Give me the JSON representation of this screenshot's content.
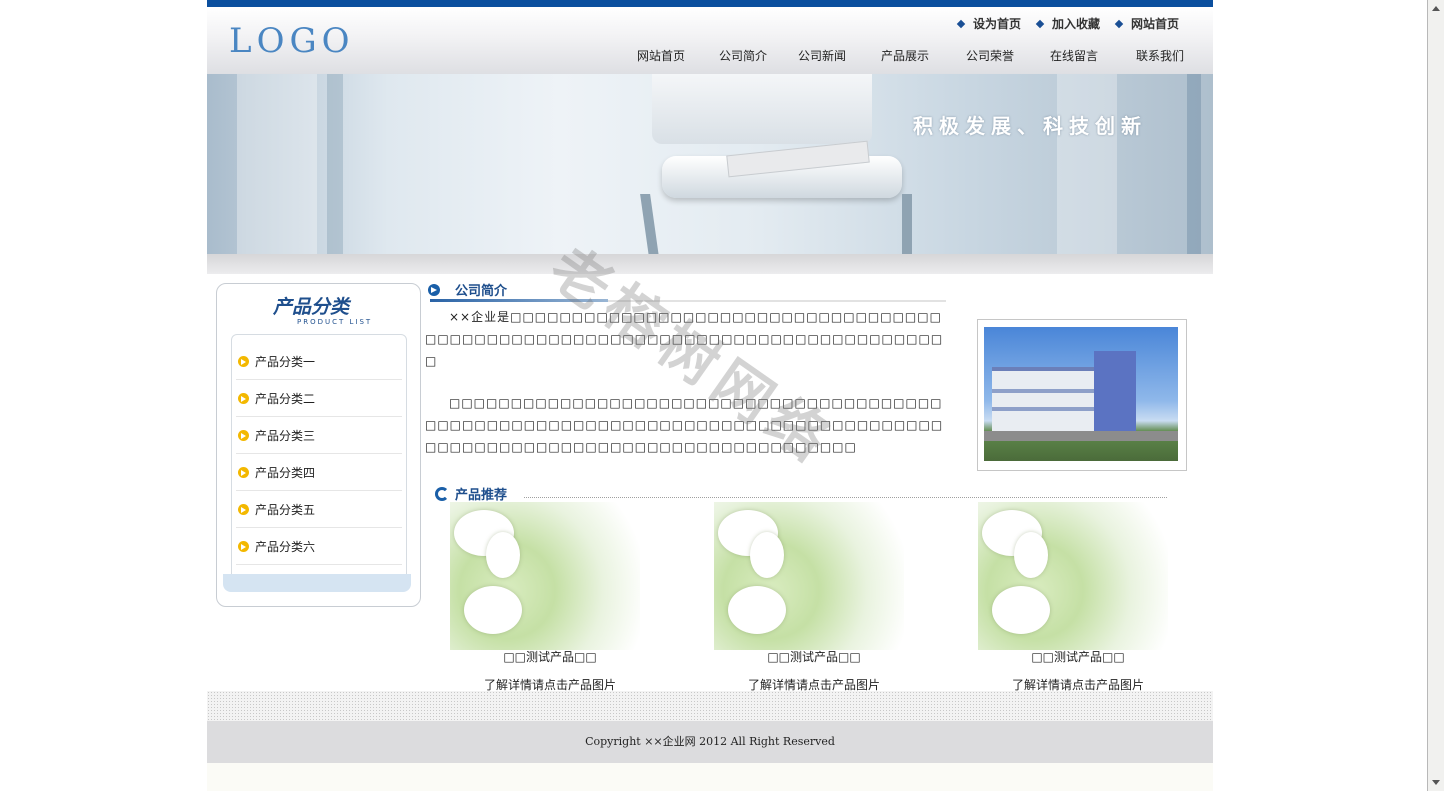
{
  "header": {
    "logo": "LOGO",
    "quick_links": [
      "设为首页",
      "加入收藏",
      "网站首页"
    ],
    "nav": [
      "网站首页",
      "公司简介",
      "公司新闻",
      "产品展示",
      "公司荣誉",
      "在线留言",
      "联系我们"
    ]
  },
  "banner": {
    "slogan": "积极发展、科技创新"
  },
  "sidebar": {
    "title": "产品分类",
    "subtitle": "PRODUCT LIST",
    "items": [
      "产品分类一",
      "产品分类二",
      "产品分类三",
      "产品分类四",
      "产品分类五",
      "产品分类六"
    ]
  },
  "intro": {
    "title": "公司简介",
    "paragraph1": "××企业是□□□□□□□□□□□□□□□□□□□□□□□□□□□□□□□□□□□□□□□□□□□□□□□□□□□□□□□□□□□□□□□□□□□□□□□□□□□□□□",
    "paragraph2": "□□□□□□□□□□□□□□□□□□□□□□□□□□□□□□□□□□□□□□□□□□□□□□□□□□□□□□□□□□□□□□□□□□□□□□□□□□□□□□□□□□□□□□□□□□□□□□□□□□□□□□□□□□□□□□□□□□□□□"
  },
  "products": {
    "title": "产品推荐",
    "items": [
      {
        "name": "□□测试产品□□",
        "link": "了解详情请点击产品图片"
      },
      {
        "name": "□□测试产品□□",
        "link": "了解详情请点击产品图片"
      },
      {
        "name": "□□测试产品□□",
        "link": "了解详情请点击产品图片"
      }
    ]
  },
  "footer": {
    "copyright": "Copyright ××企业网 2012 All Right Reserved"
  },
  "watermark": "老榕树网络",
  "colors": {
    "brand_blue": "#0b4f9e",
    "title_blue": "#1f4f8d",
    "arrow_yellow": "#f3b800"
  }
}
